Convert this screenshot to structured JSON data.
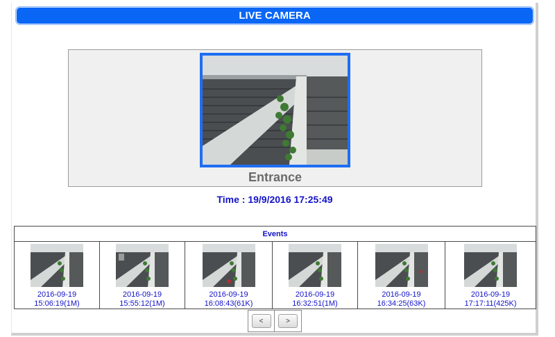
{
  "header": {
    "title": "LIVE CAMERA"
  },
  "camera": {
    "name": "Entrance",
    "time_label": "Time : 19/9/2016 17:25:49"
  },
  "events": {
    "title": "Events",
    "items": [
      {
        "date": "2016-09-19",
        "time": "15:06:19(1M)"
      },
      {
        "date": "2016-09-19",
        "time": "15:55:12(1M)"
      },
      {
        "date": "2016-09-19",
        "time": "16:08:43(61K)"
      },
      {
        "date": "2016-09-19",
        "time": "16:32:51(1M)"
      },
      {
        "date": "2016-09-19",
        "time": "16:34:25(63K)"
      },
      {
        "date": "2016-09-19",
        "time": "17:17:11(425K)"
      }
    ]
  },
  "pager": {
    "prev_label": "<",
    "next_label": ">"
  }
}
